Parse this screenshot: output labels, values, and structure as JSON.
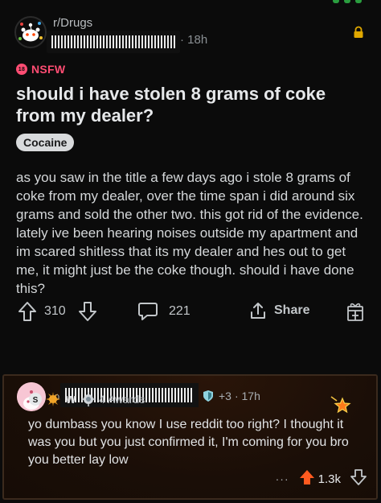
{
  "post": {
    "subreddit": "r/Drugs",
    "time": "· 18h",
    "nsfw_label": "NSFW",
    "nsfw_badge": "18",
    "title": "should i have stolen 8 grams of coke from my dealer?",
    "flair": "Cocaine",
    "body": "as you saw in the title a few days ago i stole 8 grams of coke from my dealer, over the time span i did around six grams and sold the other two. this got rid of the evidence. lately ive been hearing noises outside my apartment and im scared shitless that its my dealer and hes out to get me, it might just be the coke though. should i have done this?",
    "votes": "310",
    "comments": "221",
    "share_label": "Share",
    "icons": {
      "lock": "lock-icon",
      "upvote": "upvote-arrow-icon",
      "downvote": "downvote-arrow-icon",
      "comment": "comment-bubble-icon",
      "share": "share-icon",
      "award": "award-gift-icon"
    },
    "colors": {
      "nsfw": "#ff4d73",
      "lock": "#e0a800",
      "background": "#0b0b0b"
    }
  },
  "comment": {
    "username_prefix": "o",
    "award_count": "+3",
    "time": "· 17h",
    "awards_label": "4 Awards",
    "body": "yo dumbass you know I use reddit too right? I thought it was you but you just confirmed it, I'm coming for you bro you better lay low",
    "more": "···",
    "score": "1.3k",
    "colors": {
      "upvoted": "#ff5a1f",
      "border": "#3b2a1d",
      "background": "#1a0e07"
    }
  }
}
